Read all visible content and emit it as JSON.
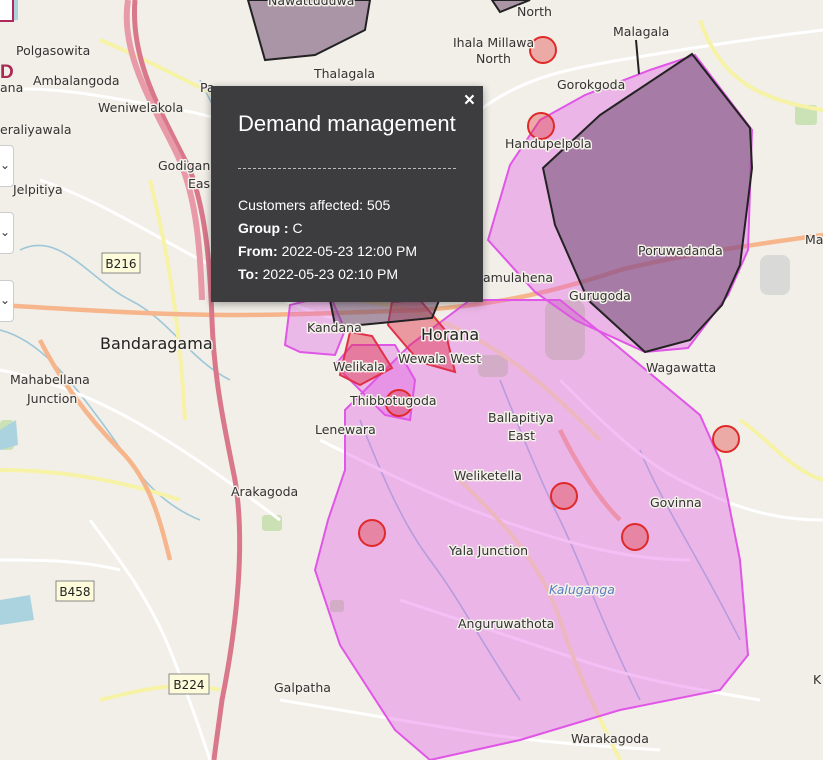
{
  "popup": {
    "title": "Demand management",
    "close_glyph": "×",
    "customers_label": "Customers affected:",
    "customers_value": "505",
    "group_label": "Group :",
    "group_value": "C",
    "from_label": "From:",
    "from_value": "2022-05-23 12:00 PM",
    "to_label": "To:",
    "to_value": "2022-05-23 02:10 PM"
  },
  "controls": {
    "chevron": "⌄"
  },
  "brand_fragment": "D",
  "places": {
    "north1": "North",
    "malagala": "Malagala",
    "ihala_millawa": "Ihala Millawa",
    "north2": "North",
    "polgasowita": "Polgasowita",
    "ambalangoda": "Ambalangoda",
    "ana": "ana",
    "thalagala": "Thalagala",
    "gorokgoda": "Gorokgoda",
    "weniwelakola": "Weniwelakola",
    "pa": "Pa",
    "eraliyawala": "eraliyawala",
    "handupelpola": "Handupelpola",
    "godigam": "Godigan",
    "east_small": "Eas",
    "jelpitiya": "Jelpitiya",
    "poruwadanda": "Poruwadanda",
    "ma": "Ma",
    "gamulahena": "amulahena",
    "gurugoda": "Gurugoda",
    "kandana": "Kandana",
    "horana": "Horana",
    "bandaragama": "Bandaragama",
    "wewala_west": "Wewala West",
    "welikala": "Welikala",
    "wagawatta": "Wagawatta",
    "mahabellana": "Mahabellana",
    "junction": "Junction",
    "thibbotugoda": "Thibbotugoda",
    "ballapitiya": "Ballapitiya",
    "ballapitiya_east": "East",
    "lenewara": "Lenewara",
    "weliketella": "Weliketella",
    "arakagoda": "Arakagoda",
    "govinna": "Govinna",
    "yala_junction": "Yala Junction",
    "kalugangа": "Kalugangа",
    "anguruwathota": "Anguruwathota",
    "galpatha": "Galpatha",
    "k": "K",
    "warakagoda": "Warakagoda",
    "nawattuduwa": "Nawattuduwa"
  },
  "roads": {
    "b216": "B216",
    "b458": "B458",
    "b224": "B224"
  },
  "colors": {
    "zone_pink": "#e056e6",
    "zone_dark": "#6e4a70",
    "zone_red": "#e0304a",
    "marker_red": "#e02a2a",
    "popup_bg": "#3d3d3f"
  }
}
